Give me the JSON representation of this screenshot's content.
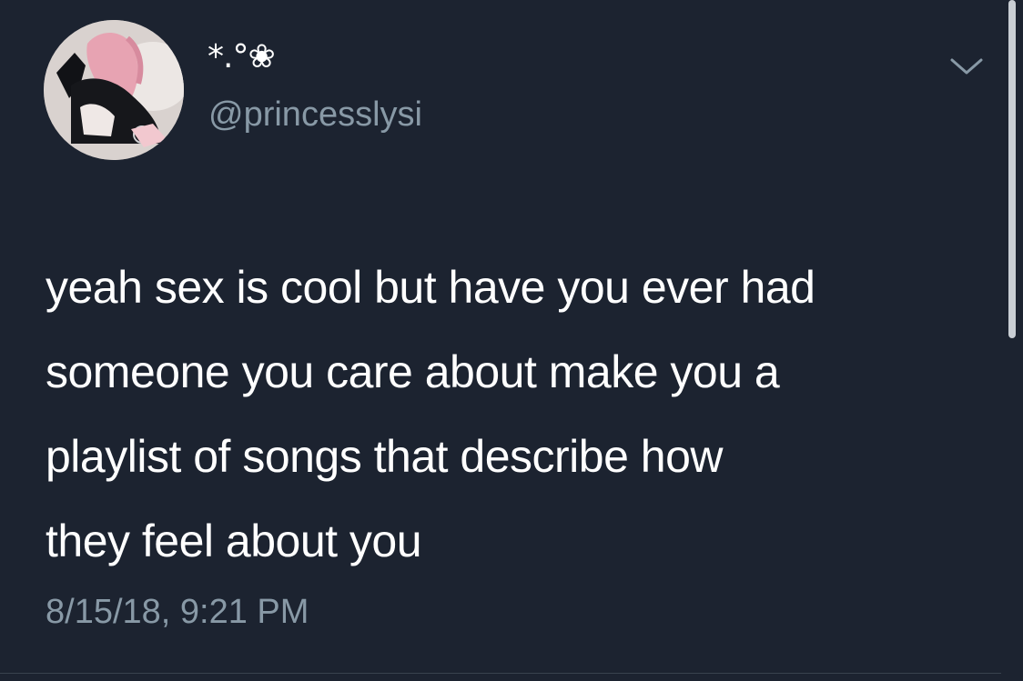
{
  "tweet": {
    "display_name": "*.°❀",
    "handle": "@princesslysi",
    "text_lines": [
      "yeah sex is cool but have you ever had",
      "someone you care about make you a",
      "playlist of songs that describe how",
      "they feel about you"
    ],
    "timestamp": "8/15/18, 9:21 PM",
    "avatar_icon": "profile-photo",
    "menu_icon": "chevron-down-icon"
  },
  "colors": {
    "background": "#1c2330",
    "primary_text": "#ffffff",
    "secondary_text": "#8899a6",
    "scrollbar": "#c9ced4"
  }
}
